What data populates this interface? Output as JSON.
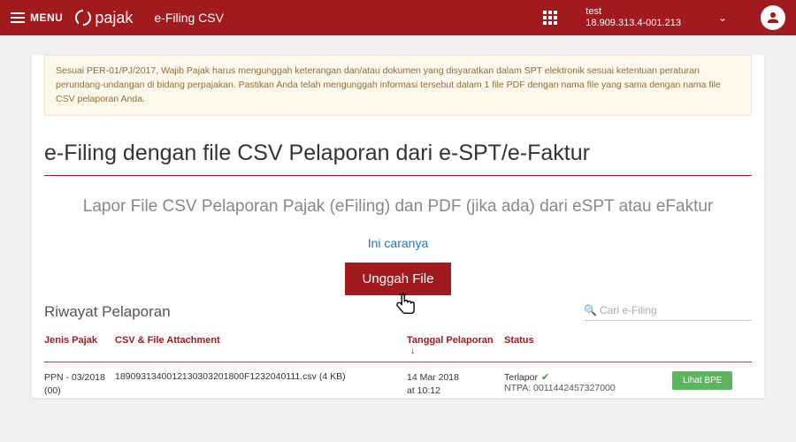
{
  "topbar": {
    "menu_label": "MENU",
    "logo_text": "pajak",
    "app_title": "e-Filing CSV",
    "user_name": "test",
    "user_id": "18.909.313.4-001.213"
  },
  "notice": "Sesuai PER-01/PJ/2017, Wajib Pajak harus mengunggah keterangan dan/atau dokumen yang disyaratkan dalam SPT elektronik sesuai ketentuan peraturan perundang-undangan di bidang perpajakan. Pastikan Anda telah mengunggah informasi tersebut dalam 1 file PDF dengan nama file yang sama dengan nama file CSV pelaporan Anda.",
  "main": {
    "title": "e-Filing dengan file CSV Pelaporan dari e-SPT/e-Faktur",
    "subtitle": "Lapor File CSV Pelaporan Pajak (eFiling) dan PDF (jika ada) dari eSPT atau eFaktur",
    "howto_link": "Ini caranya",
    "upload_button": "Unggah File"
  },
  "history": {
    "title": "Riwayat Pelaporan",
    "search_placeholder": "Cari e-Filing"
  },
  "table": {
    "headers": {
      "jenis": "Jenis Pajak",
      "csv": "CSV & File Attachment",
      "tanggal": "Tanggal Pelaporan",
      "status": "Status"
    },
    "rows": [
      {
        "jenis_line1": "PPN - 03/2018",
        "jenis_line2": "(00)",
        "csv": "1890931340012130303201800F1232040111.csv (4 KB)",
        "tgl_line1": "14 Mar 2018",
        "tgl_line2": "at 10:12",
        "status_label": "Terlapor",
        "status_ntpa": "NTPA: 0011442457327000",
        "action": "Lihat BPE"
      }
    ]
  }
}
